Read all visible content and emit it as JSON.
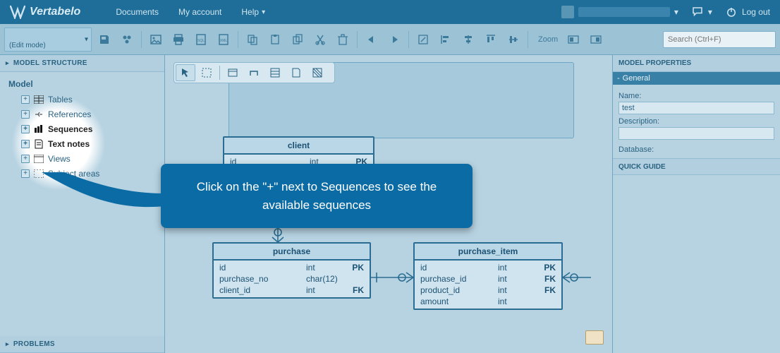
{
  "brand": "Vertabelo",
  "header": {
    "nav": [
      "Documents",
      "My account",
      "Help"
    ],
    "logout": "Log out"
  },
  "toolbar": {
    "mode_label": "(Edit mode)",
    "zoom_label": "Zoom",
    "search_placeholder": "Search (Ctrl+F)"
  },
  "sidebar": {
    "title": "MODEL STRUCTURE",
    "root": "Model",
    "items": [
      {
        "label": "Tables",
        "icon": "table"
      },
      {
        "label": "References",
        "icon": "reference"
      },
      {
        "label": "Sequences",
        "icon": "sequence",
        "bold": true
      },
      {
        "label": "Text notes",
        "icon": "note",
        "bold": true
      },
      {
        "label": "Views",
        "icon": "view"
      },
      {
        "label": "Subject areas",
        "icon": "area"
      }
    ],
    "problems_title": "PROBLEMS"
  },
  "callout_text": "Click on the \"+\" next to Sequences to see the available sequences",
  "tables": {
    "client": {
      "title": "client",
      "rows": [
        {
          "name": "id",
          "type": "int",
          "key": "PK"
        }
      ]
    },
    "purchase": {
      "title": "purchase",
      "rows": [
        {
          "name": "id",
          "type": "int",
          "key": "PK"
        },
        {
          "name": "purchase_no",
          "type": "char(12)",
          "key": ""
        },
        {
          "name": "client_id",
          "type": "int",
          "key": "FK"
        }
      ]
    },
    "purchase_item": {
      "title": "purchase_item",
      "rows": [
        {
          "name": "id",
          "type": "int",
          "key": "PK"
        },
        {
          "name": "purchase_id",
          "type": "int",
          "key": "FK"
        },
        {
          "name": "product_id",
          "type": "int",
          "key": "FK"
        },
        {
          "name": "amount",
          "type": "int",
          "key": ""
        }
      ]
    }
  },
  "right": {
    "panel_title": "MODEL PROPERTIES",
    "section": "General",
    "name_label": "Name:",
    "name_value": "test",
    "desc_label": "Description:",
    "db_label": "Database:",
    "quick_guide": "QUICK GUIDE"
  }
}
